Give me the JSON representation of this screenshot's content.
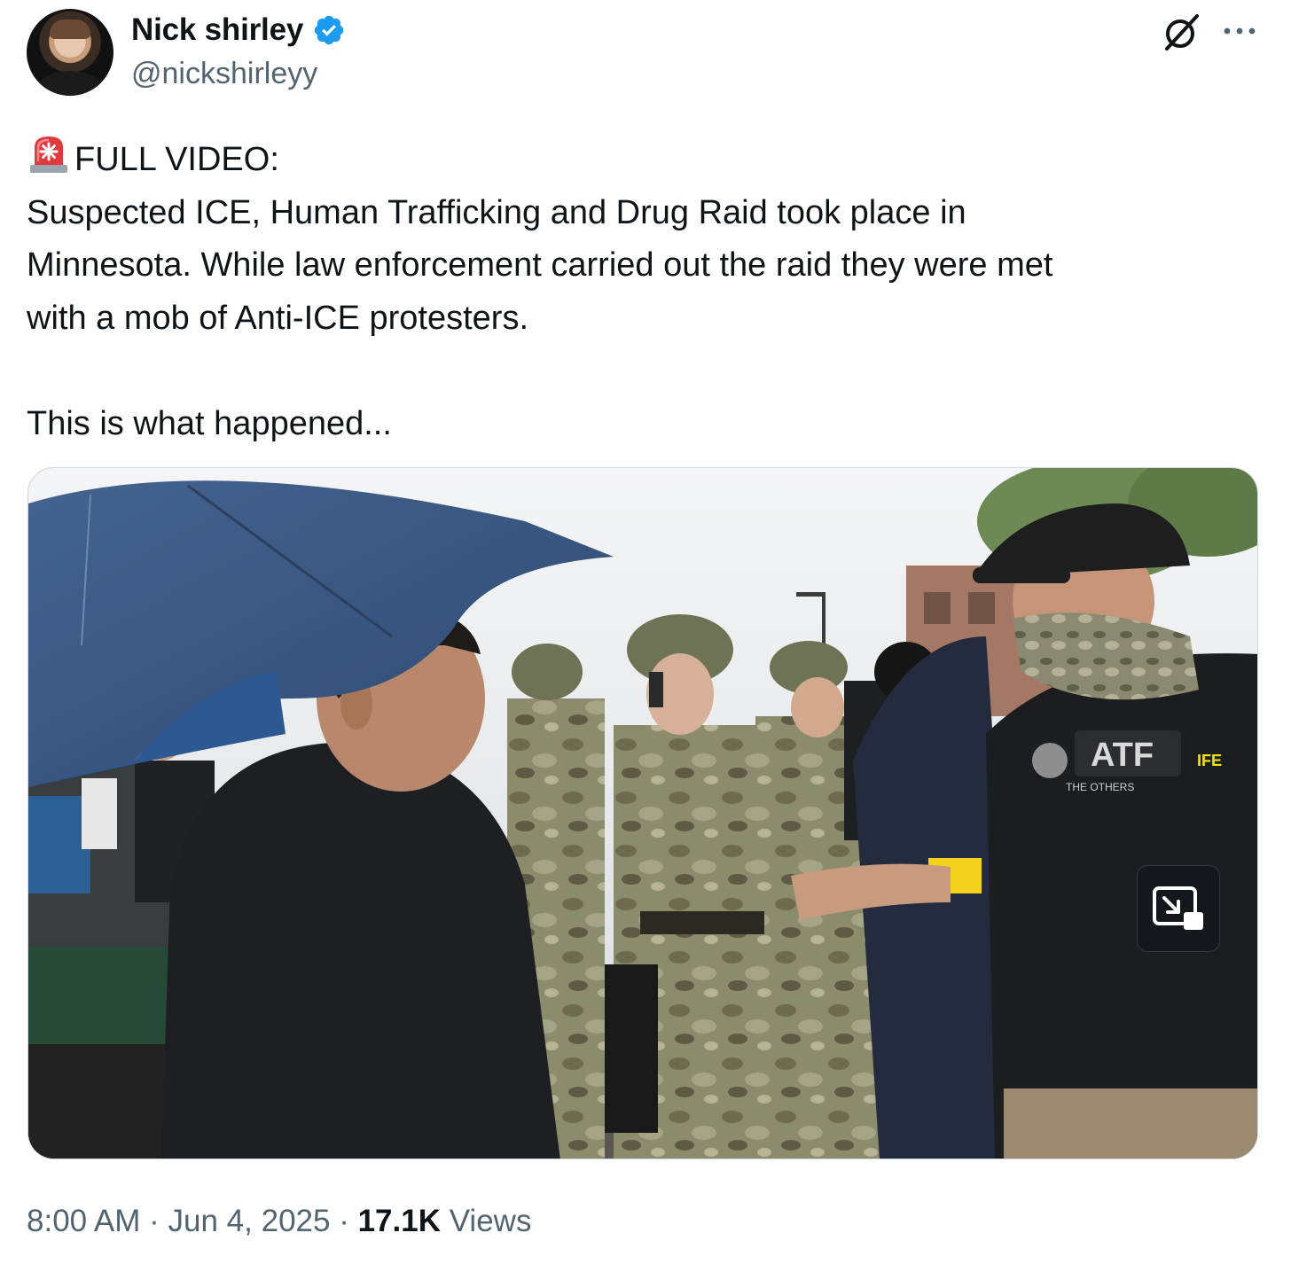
{
  "author": {
    "name": "Nick shirley",
    "handle": "@nickshirleyy",
    "verified": true
  },
  "icons": {
    "verified": "verified-badge-icon",
    "grok": "grok-icon",
    "more": "more-options-icon",
    "siren": "rotating-light-emoji-icon",
    "pip": "picture-in-picture-icon"
  },
  "colors": {
    "verified_blue": "#1d9bf0",
    "text": "#0f1419",
    "secondary": "#536471"
  },
  "tweet": {
    "line1": "FULL VIDEO:",
    "line2": "Suspected ICE, Human Trafficking and Drug Raid took place in",
    "line3": "Minnesota. While law enforcement carried out the raid they were met",
    "line4": "with a mob of Anti-ICE protesters.",
    "line5": "This is what happened..."
  },
  "media": {
    "vest_patch": "ATF",
    "vest_subpatch": "THE OTHERS",
    "vest_side_patch": "IFE"
  },
  "meta": {
    "time": "8:00 AM",
    "sep1": " · ",
    "date": "Jun 4, 2025",
    "sep2": " · ",
    "views_count": "17.1K",
    "views_label": " Views"
  }
}
